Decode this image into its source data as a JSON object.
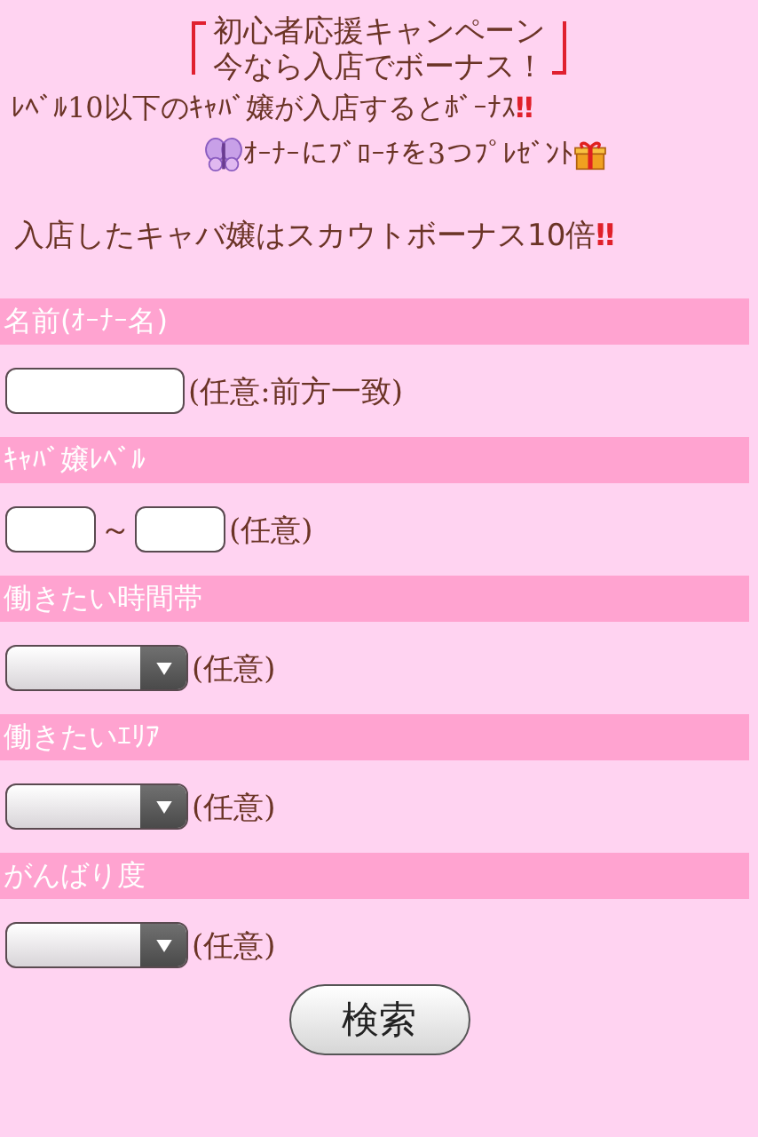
{
  "campaign": {
    "title_lines": [
      "初心者応援キャンペーン",
      "今なら入店でボーナス！"
    ]
  },
  "notices": [
    {
      "kind": "plain",
      "text": "ﾚﾍﾞﾙ10以下のｷｬﾊﾞ嬢が入店するとﾎﾞｰﾅｽ",
      "mark": "‼"
    },
    {
      "kind": "present",
      "text": "ｵｰﾅｰにﾌﾞﾛｰﾁを3つﾌﾟﾚｾﾞﾝﾄ"
    },
    {
      "kind": "plain",
      "text": "入店したキャバ嬢はスカウトボーナス10倍",
      "mark": "‼"
    }
  ],
  "form": {
    "sections": [
      {
        "label": "名前(ｵｰﾅｰ名)",
        "kind": "text",
        "note": "(任意:前方一致)"
      },
      {
        "label": "ｷｬﾊﾞ嬢ﾚﾍﾞﾙ",
        "kind": "range",
        "range_sep": "～",
        "note": "(任意)"
      },
      {
        "label": "働きたい時間帯",
        "kind": "select",
        "note": "(任意)"
      },
      {
        "label": "働きたいｴﾘｱ",
        "kind": "select",
        "note": "(任意)"
      },
      {
        "label": "がんばり度",
        "kind": "select",
        "note": "(任意)"
      }
    ],
    "submit": "検索"
  }
}
